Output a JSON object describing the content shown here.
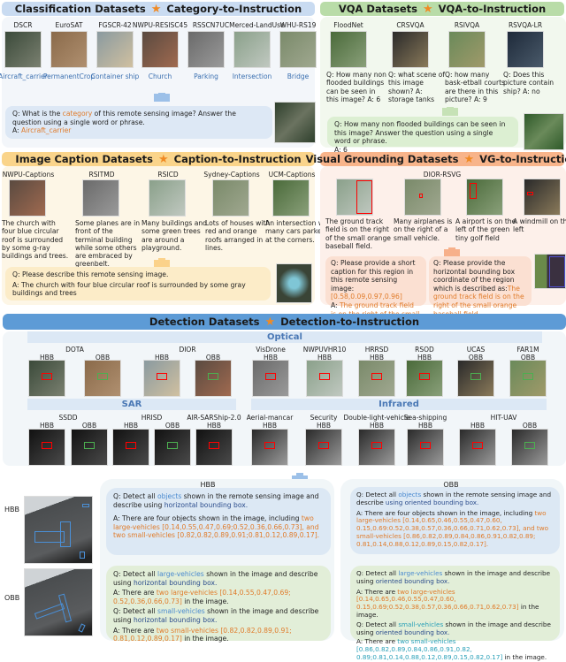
{
  "classification": {
    "title": "Classification Datasets",
    "subtitle": "Category-to-Instruction",
    "datasets": [
      {
        "name": "DSCR",
        "label": "Aircraft_carrier"
      },
      {
        "name": "EuroSAT",
        "label": "PermanentCrop"
      },
      {
        "name": "FGSCR-42",
        "label": "Container ship"
      },
      {
        "name": "NWPU-RESISC45",
        "label": "Church"
      },
      {
        "name": "RSSCN7",
        "label": "Parking"
      },
      {
        "name": "UCMerced-LandUse",
        "label": "Intersection"
      },
      {
        "name": "WHU-RS19",
        "label": "Bridge"
      }
    ],
    "qa": [
      [
        {
          "t": "Q: What is the "
        },
        {
          "t": "category",
          "c": "o"
        },
        {
          "t": " of this remote sensing image? Answer the question using a single word or phrase."
        }
      ],
      [
        {
          "t": "A: "
        },
        {
          "t": "Aircraft_carrier",
          "c": "o"
        }
      ]
    ]
  },
  "vqa": {
    "title": "VQA Datasets",
    "subtitle": "VQA-to-Instruction",
    "datasets": [
      {
        "name": "FloodNet",
        "text": "Q: How many non flooded buildings can be seen in this image?  A: 6"
      },
      {
        "name": "CRSVQA",
        "text": "Q: what scene of this image shown? A: storage tanks"
      },
      {
        "name": "RSIVQA",
        "text": "Q: how many bask-etball courts are there in this picture? A: 9"
      },
      {
        "name": "RSVQA-LR",
        "text": "Q: Does this picture contain ship? A: no"
      }
    ],
    "qa": [
      [
        {
          "t": "Q: How many non flooded buildings can be seen in this image? Answer the question using a single word or phrase."
        }
      ],
      [
        {
          "t": "A: 6"
        }
      ]
    ]
  },
  "caption": {
    "title": "Image Caption Datasets",
    "subtitle": "Caption-to-Instruction",
    "datasets": [
      {
        "name": "NWPU-Captions",
        "text": "The church with four blue circular roof is surrounded by some g-ray buildings and trees."
      },
      {
        "name": "RSITMD",
        "text": "Some planes are in front of the terminal building while some others are embraced by greenbelt."
      },
      {
        "name": "RSICD",
        "text": "Many buildings and some green trees are around a playground."
      },
      {
        "name": "Sydney-Captions",
        "text": "Lots of houses with red and orange roofs arranged in lines."
      },
      {
        "name": "UCM-Captions",
        "text": "An intersection with many cars parked at the corners."
      }
    ],
    "qa": [
      [
        {
          "t": "Q: Please describe this remote sensing image."
        }
      ],
      [
        {
          "t": "A: The church with four blue circular roof is surrounded by some gray buildings and trees"
        }
      ]
    ]
  },
  "vg": {
    "title": "Visual Grounding Datasets",
    "subtitle": "VG-to-Instruction",
    "dataset": "DIOR-RSVG",
    "captions": [
      "The ground track field is on the right of the small orange baseball field.",
      "Many airplanes is on the right of a small vehicle.",
      "A airport is on the left of the green tiny golf field",
      "A windmill on the left"
    ],
    "qa1": [
      [
        {
          "t": "Q: Please provide a short caption for this region in this remote sensing image: "
        },
        {
          "t": "[0.58,0.09,0.97,0.96]",
          "c": "o"
        }
      ],
      [
        {
          "t": "A: "
        },
        {
          "t": "The ground track field is on the right of the small orange baseball field",
          "c": "o"
        }
      ]
    ],
    "qa2": [
      [
        {
          "t": "Q: Please provide the horizontal bounding box coordinate of the region which is described as:"
        },
        {
          "t": "The ground track field is on the right of the small orange baseball field",
          "c": "o"
        }
      ],
      [
        {
          "t": "A: "
        },
        {
          "t": "[0.58,0.09,0.97,0.96]",
          "c": "o"
        }
      ]
    ]
  },
  "detection": {
    "title": "Detection Datasets",
    "subtitle": "Detection-to-Instruction",
    "optical_label": "Optical",
    "sar_label": "SAR",
    "infrared_label": "Infrared",
    "optical": [
      {
        "name": "DOTA",
        "types": [
          "HBB",
          "OBB"
        ]
      },
      {
        "name": "DIOR",
        "types": [
          "HBB",
          "OBB"
        ]
      },
      {
        "name": "VisDrone",
        "types": [
          "HBB"
        ]
      },
      {
        "name": "NWPUVHR10",
        "types": [
          "HBB"
        ]
      },
      {
        "name": "HRRSD",
        "types": [
          "HBB"
        ]
      },
      {
        "name": "RSOD",
        "types": [
          "HBB"
        ]
      },
      {
        "name": "UCAS",
        "types": [
          "OBB"
        ]
      },
      {
        "name": "FAR1M",
        "types": [
          "OBB"
        ]
      }
    ],
    "sar": [
      {
        "name": "SSDD",
        "types": [
          "HBB",
          "OBB"
        ]
      },
      {
        "name": "HRISD",
        "types": [
          "HBB",
          "OBB"
        ]
      },
      {
        "name": "AIR-SARShip-2.0",
        "types": [
          "HBB"
        ]
      }
    ],
    "infrared": [
      {
        "name": "Aerial-mancar",
        "types": [
          "HBB"
        ]
      },
      {
        "name": "Security",
        "types": [
          "HBB"
        ]
      },
      {
        "name": "Double-light-vehicle",
        "types": [
          "HBB"
        ]
      },
      {
        "name": "Sea-shipping",
        "types": [
          "HBB"
        ]
      },
      {
        "name": "HIT-UAV",
        "types": [
          "HBB",
          "OBB"
        ]
      }
    ]
  },
  "bottom": {
    "hbb_label": "HBB",
    "obb_label": "OBB",
    "hbb_title": "HBB",
    "obb_title": "OBB",
    "hbb_all": [
      [
        {
          "t": "Q: Detect all "
        },
        {
          "t": "objects",
          "c": "b"
        },
        {
          "t": " shown in the remote sensing image and describe using "
        },
        {
          "t": "horizontal bounding box.",
          "c": "n"
        }
      ],
      [
        {
          "t": "A: There are four objects shown in the image, including "
        },
        {
          "t": "two large-vehicles [0.14,0.55,0.47,0.69;0.52,0.36,0.66,0.73], and two small-vehicles [0.82,0.82,0.89,0.91;0.81,0.12,0.89,0.17].",
          "c": "o"
        }
      ]
    ],
    "hbb_split": [
      [
        {
          "t": "Q: Detect all "
        },
        {
          "t": "large-vehicles",
          "c": "b"
        },
        {
          "t": " shown in the image and describe using "
        },
        {
          "t": "horizontal bounding box.",
          "c": "n"
        }
      ],
      [
        {
          "t": "A: There are  "
        },
        {
          "t": "two large-vehicles [0.14,0.55,0.47,0.69; 0.52,0.36,0.66,0.73]",
          "c": "o"
        },
        {
          "t": " in the image."
        }
      ],
      [
        {
          "t": "Q: Detect all "
        },
        {
          "t": "small-vehicles",
          "c": "b"
        },
        {
          "t": " shown in the image and describe using "
        },
        {
          "t": "horizontal bounding box.",
          "c": "n"
        }
      ],
      [
        {
          "t": "A: There are "
        },
        {
          "t": "two small-vehicles [0.82,0.82,0.89,0.91; 0.81,0.12,0.89,0.17]",
          "c": "o"
        },
        {
          "t": " in the image."
        }
      ]
    ],
    "obb_all": [
      [
        {
          "t": "Q: Detect all "
        },
        {
          "t": "objects",
          "c": "b"
        },
        {
          "t": " shown in the remote sensing image and describe "
        },
        {
          "t": "using oriented bounding box.",
          "c": "n"
        }
      ],
      [
        {
          "t": "A: There are four objects shown in the image, including "
        },
        {
          "t": "two large-vehicles [0.14,0.65,0.46,0.55,0.47,0.60, 0.15,0.69:0.52,0.38,0.57,0.36,0.66,0.71,0.62,0.73], and  two small-vehicles [0.86,0.82,0.89,0.84,0.86,0.91,0.82,0.89; 0.81,0.14,0.88,0.12,0.89,0.15,0.82,0.17].",
          "c": "o"
        }
      ]
    ],
    "obb_split": [
      [
        {
          "t": "Q: Detect all "
        },
        {
          "t": "large-vehicles",
          "c": "b"
        },
        {
          "t": " shown in the image and describe using "
        },
        {
          "t": "oriented bounding box.",
          "c": "n"
        }
      ],
      [
        {
          "t": "A: There are "
        },
        {
          "t": "two large-vehicles [0.14,0.65,0.46,0.55,0.47,0.60, 0.15,0.69;0.52,0.38,0.57,0.36,0.66,0.71,0.62,0.73]",
          "c": "o"
        },
        {
          "t": " in the image."
        }
      ],
      [
        {
          "t": "Q: Detect all "
        },
        {
          "t": "small-vehicles",
          "c": "t"
        },
        {
          "t": " shown in the image and describe using "
        },
        {
          "t": "oriented bounding box.",
          "c": "n"
        }
      ],
      [
        {
          "t": "A: There are "
        },
        {
          "t": "two small-vehicles [0.86,0.82,0.89,0.84,0.86,0.91,0.82, 0.89;0.81,0.14,0.88,0.12,0.89,0.15,0.82,0.17]",
          "c": "t"
        },
        {
          "t": " in the image."
        }
      ]
    ]
  },
  "colors": {
    "classification": "#c9dbf1",
    "vqa": "#b9dca8",
    "caption": "#fad48a",
    "vg": "#f8b48a",
    "detection": "#5d9bd6",
    "accent_orange": "#e07b2a"
  }
}
